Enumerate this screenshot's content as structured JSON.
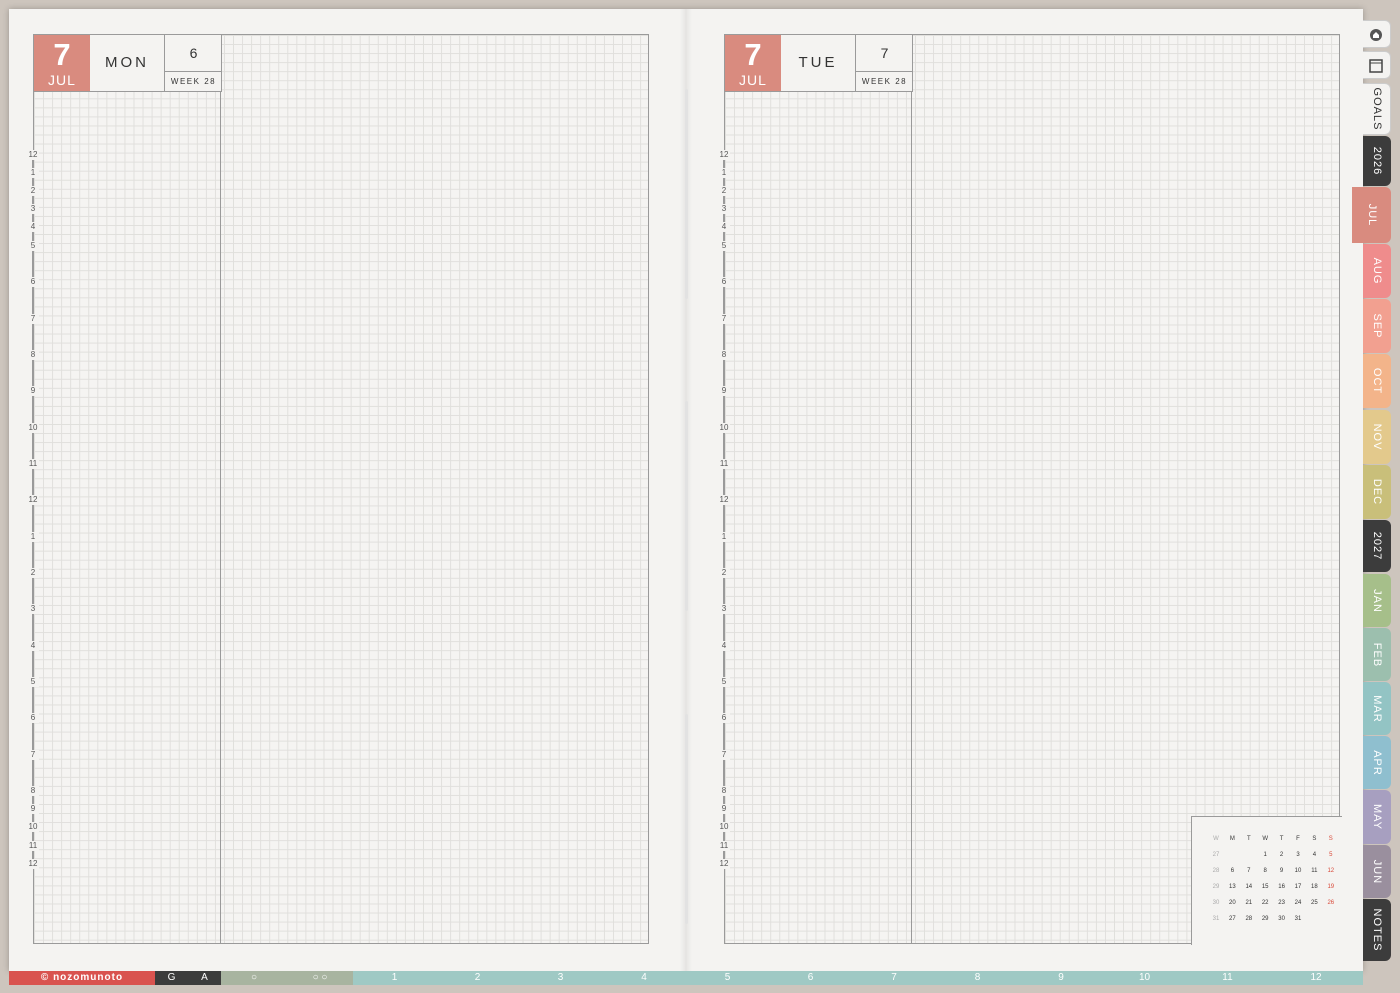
{
  "left_page": {
    "date_number": "7",
    "month": "JUL",
    "day_name": "MON",
    "week_number": "6",
    "week_label": "WEEK 28"
  },
  "right_page": {
    "date_number": "7",
    "month": "JUL",
    "day_name": "TUE",
    "week_number": "7",
    "week_label": "WEEK 28"
  },
  "hours": [
    "12",
    "1",
    "2",
    "3",
    "4",
    "5",
    "6",
    "7",
    "8",
    "9",
    "10",
    "11",
    "12",
    "1",
    "2",
    "3",
    "4",
    "5",
    "6",
    "7",
    "8",
    "9",
    "10",
    "11",
    "12"
  ],
  "mini_calendar": {
    "headers": [
      "W",
      "M",
      "T",
      "W",
      "T",
      "F",
      "S",
      "S"
    ],
    "rows": [
      [
        "27",
        "",
        "",
        "1",
        "2",
        "3",
        "4",
        "5"
      ],
      [
        "28",
        "6",
        "7",
        "8",
        "9",
        "10",
        "11",
        "12"
      ],
      [
        "29",
        "13",
        "14",
        "15",
        "16",
        "17",
        "18",
        "19"
      ],
      [
        "30",
        "20",
        "21",
        "22",
        "23",
        "24",
        "25",
        "26"
      ],
      [
        "31",
        "27",
        "28",
        "29",
        "30",
        "31",
        "",
        ""
      ]
    ]
  },
  "side_tabs": [
    {
      "label": "GOALS",
      "color": "#f4f3f1",
      "text_color": "#333"
    },
    {
      "label": "2026",
      "color": "#3c3c3c",
      "text_color": "#ffffff"
    },
    {
      "label": "JUL",
      "color": "#d98b7f",
      "text_color": "#ffffff"
    },
    {
      "label": "AUG",
      "color": "#ef8c8c",
      "text_color": "#ffffff"
    },
    {
      "label": "SEP",
      "color": "#f2a090",
      "text_color": "#ffffff"
    },
    {
      "label": "OCT",
      "color": "#f3b48a",
      "text_color": "#ffffff"
    },
    {
      "label": "NOV",
      "color": "#e3c98c",
      "text_color": "#ffffff"
    },
    {
      "label": "DEC",
      "color": "#c9bf7a",
      "text_color": "#ffffff"
    },
    {
      "label": "2027",
      "color": "#3c3c3c",
      "text_color": "#ffffff"
    },
    {
      "label": "JAN",
      "color": "#a6bf8a",
      "text_color": "#ffffff"
    },
    {
      "label": "FEB",
      "color": "#9cbfae",
      "text_color": "#ffffff"
    },
    {
      "label": "MAR",
      "color": "#93c4c4",
      "text_color": "#ffffff"
    },
    {
      "label": "APR",
      "color": "#8fbfcf",
      "text_color": "#ffffff"
    },
    {
      "label": "MAY",
      "color": "#a79fc0",
      "text_color": "#ffffff"
    },
    {
      "label": "JUN",
      "color": "#9a8f9e",
      "text_color": "#ffffff"
    },
    {
      "label": "NOTES",
      "color": "#3c3c3c",
      "text_color": "#ffffff"
    }
  ],
  "bottom_tabs": {
    "brand": "© nozomunoto",
    "items": [
      "G",
      "A",
      "○",
      "○ ○",
      "1",
      "2",
      "3",
      "4",
      "5",
      "6",
      "7",
      "8",
      "9",
      "10",
      "11",
      "12"
    ]
  },
  "colors": {
    "accent": "#d98b7f",
    "paper": "#f4f3f1",
    "grid_line": "#e0dfdc",
    "border": "#9a9a9a",
    "brand_bar": "#d9534f"
  }
}
